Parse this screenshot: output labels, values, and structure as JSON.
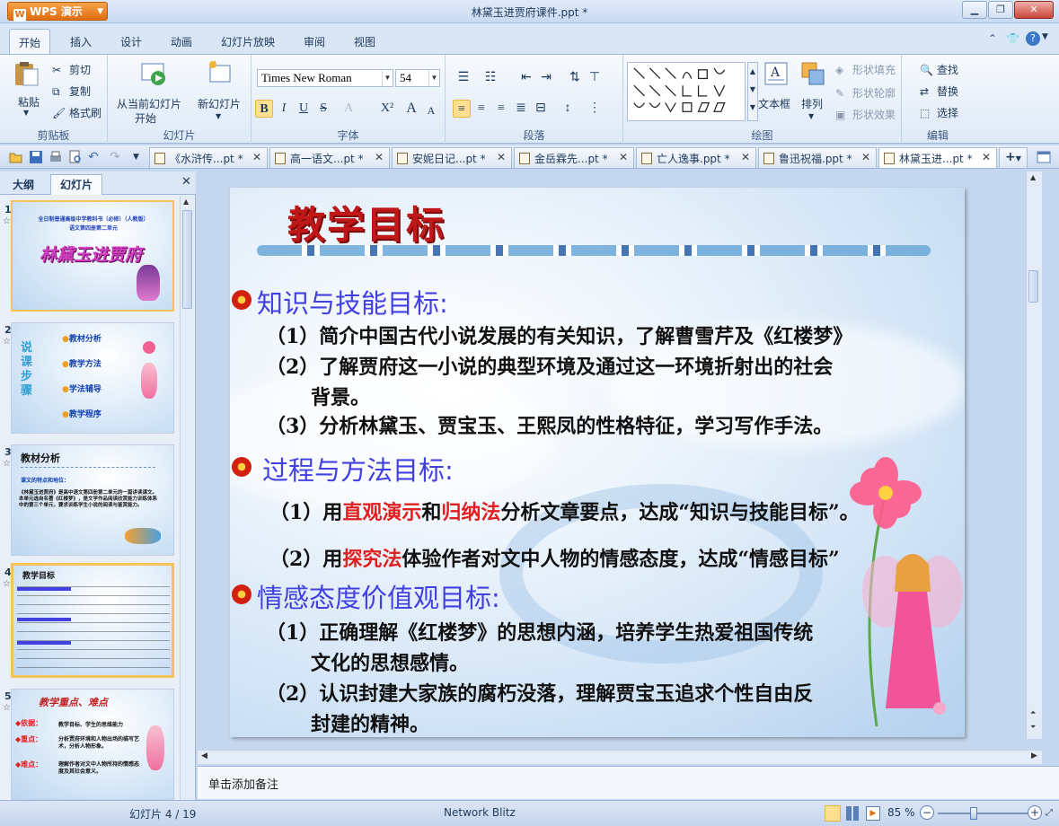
{
  "app": {
    "name": "WPS 演示",
    "window_title": "林黛玉进贾府课件.ppt *"
  },
  "window_controls": [
    "min",
    "restore",
    "close"
  ],
  "ribbon_tabs": [
    "开始",
    "插入",
    "设计",
    "动画",
    "幻灯片放映",
    "审阅",
    "视图"
  ],
  "clipboard": {
    "paste": "粘贴",
    "cut": "剪切",
    "copy": "复制",
    "format_painter": "格式刷",
    "label": "剪贴板"
  },
  "slides_group": {
    "from_current": "从当前幻灯片",
    "start": "开始",
    "new_slide": "新幻灯片",
    "label": "幻灯片"
  },
  "font": {
    "name": "Times New Roman",
    "size": "54",
    "bold": "B",
    "italic": "I",
    "underline": "U",
    "strike": "S",
    "color": "A",
    "superscript": "X²",
    "grow": "A",
    "shrink": "A",
    "label": "字体"
  },
  "paragraph": {
    "label": "段落"
  },
  "drawing": {
    "textbox": "文本框",
    "arrange": "排列",
    "shape_fill": "形状填充",
    "shape_outline": "形状轮廓",
    "shape_effect": "形状效果",
    "label": "绘图"
  },
  "editing": {
    "find": "查找",
    "replace": "替换",
    "select": "选择",
    "label": "编辑"
  },
  "doc_tabs": [
    "《水浒传...pt *",
    "高一语文...pt *",
    "安妮日记...pt *",
    "金岳霖先...pt *",
    "亡人逸事.ppt *",
    "鲁迅祝福.ppt *",
    "林黛玉进...pt *"
  ],
  "left_panel": {
    "tab_outline": "大纲",
    "tab_slides": "幻灯片"
  },
  "thumbnails": [
    {
      "num": "1",
      "line1": "全日制普通高级中学教科书（必修）（人教版）",
      "line2": "语文第四册第二单元",
      "title": "林黛玉进贾府"
    },
    {
      "num": "2",
      "side": "说课步骤",
      "items": [
        "教材分析",
        "教学方法",
        "学法辅导",
        "教学程序"
      ]
    },
    {
      "num": "3",
      "title": "教材分析",
      "sub": "课文的特点和地位：",
      "body": "《林黛玉进贾府》是高中语文第四册第二单元的一篇讲读课文。本单元选自名著《红楼梦》，是文学作品阅读欣赏能力训练体系中的第三个单元，要求训练学生小说的阅读与鉴赏能力。"
    },
    {
      "num": "4",
      "title": "教学目标"
    },
    {
      "num": "5",
      "title": "教学重点、难点",
      "items": [
        "依据：",
        "教学目标、学生的思维能力",
        "重点：",
        "分析贾府环境和人物出场的描写艺术，分析人物形象。",
        "难点：",
        "理解作者对文中人物所持的情感态度及其社会意义。"
      ]
    }
  ],
  "slide": {
    "title": "教学目标",
    "h1": "知识与技能目标:",
    "k1": "（1）简介中国古代小说发展的有关知识，了解曹雪芹及《红楼梦》",
    "k2a": "（2）了解贾府这一小说的典型环境及通过这一环境折射出的社会",
    "k2b": "背景。",
    "k3": "（3）分析林黛玉、贾宝玉、王熙凤的性格特征，学习写作手法。",
    "h2": "过程与方法目标:",
    "p1_pre": "（1）用",
    "p1_r1": "直观演示",
    "p1_mid": "和",
    "p1_r2": "归纳法",
    "p1_post": "分析文章要点，达成“知识与技能目标”。",
    "p2_pre": "（2）用",
    "p2_r1": "探究法",
    "p2_post": "体验作者对文中人物的情感态度，达成“情感目标”",
    "h3": "情感态度价值观目标:",
    "e1a": "（1）正确理解《红楼梦》的思想内涵，培养学生热爱祖国传统",
    "e1b": "文化的思想感情。",
    "e2a": "（2）认识封建大家族的腐朽没落，理解贾宝玉追求个性自由反",
    "e2b": "封建的精神。"
  },
  "notes_placeholder": "单击添加备注",
  "status": {
    "slide_index": "幻灯片 4 / 19",
    "theme": "Network Blitz",
    "zoom": "85 %"
  },
  "colors": {
    "accent": "#e06d10",
    "ribbon_bg": "#dde9f7",
    "heading_blue": "#4240e0",
    "title_red": "#c01818",
    "emphasis_red": "#e02020"
  }
}
